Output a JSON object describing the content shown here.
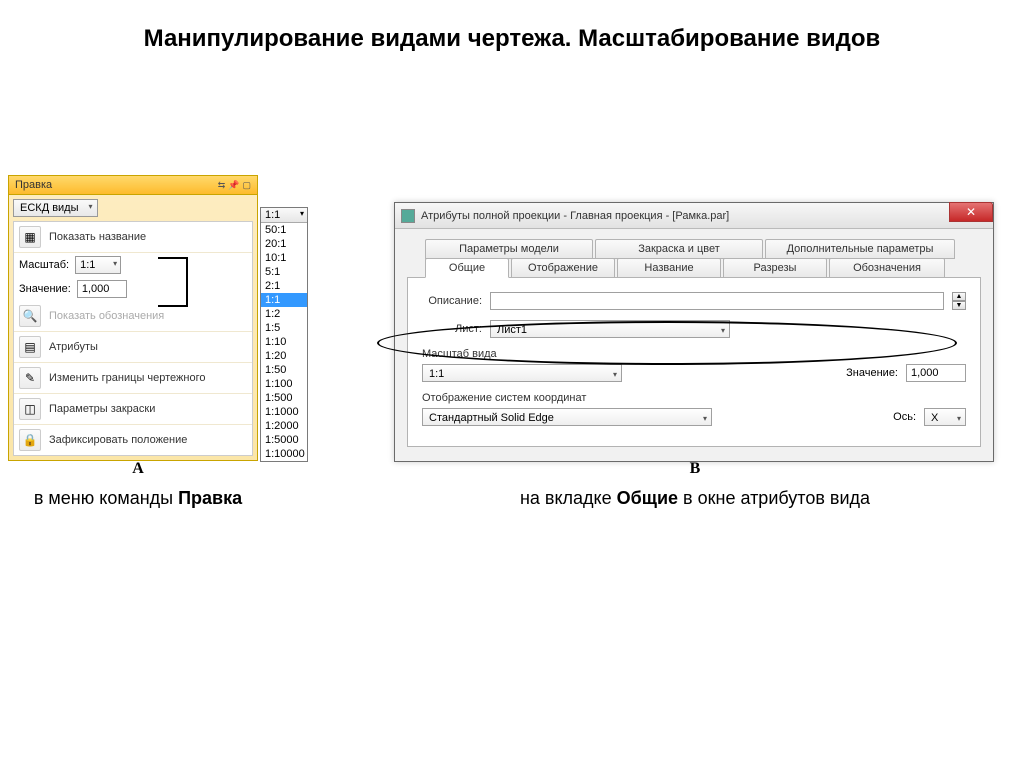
{
  "page_title": "Манипулирование видами чертежа. Масштабирование видов",
  "panel_a": {
    "header": "Правка",
    "dropdown": "ЕСКД виды",
    "show_name": "Показать название",
    "scale_label": "Масштаб:",
    "scale_value": "1:1",
    "value_label": "Значение:",
    "value_num": "1,000",
    "rows": {
      "show_designations": "Показать обозначения",
      "attributes": "Атрибуты",
      "change_bounds": "Изменить границы чертежного",
      "fill_params": "Параметры закраски",
      "lock_position": "Зафиксировать положение"
    }
  },
  "scale_list": {
    "header": "1:1",
    "items": [
      "50:1",
      "20:1",
      "10:1",
      "5:1",
      "2:1",
      "1:1",
      "1:2",
      "1:5",
      "1:10",
      "1:20",
      "1:50",
      "1:100",
      "1:500",
      "1:1000",
      "1:2000",
      "1:5000",
      "1:10000"
    ],
    "selected_index": 5
  },
  "dialog": {
    "title": "Атрибуты полной проекции - Главная проекция - [Рамка.par]",
    "tabs_row1": [
      "Параметры модели",
      "Закраска и цвет",
      "Дополнительные параметры"
    ],
    "tabs_row2": [
      "Общие",
      "Отображение",
      "Название",
      "Разрезы",
      "Обозначения"
    ],
    "desc_label": "Описание:",
    "sheet_label": "Лист:",
    "sheet_value": "Лист1",
    "scale_group": "Масштаб вида",
    "scale_value": "1:1",
    "value_label": "Значение:",
    "value_num": "1,000",
    "coord_group": "Отображение систем координат",
    "coord_value": "Стандартный Solid Edge",
    "axis_label": "Ось:",
    "axis_value": "X"
  },
  "captions": {
    "a_letter": "A",
    "a_text_1": "в меню команды ",
    "a_text_bold": "Правка",
    "b_letter": "B",
    "b_text_1": "на вкладке ",
    "b_text_bold": "Общие",
    "b_text_2": " в окне атрибутов вида"
  }
}
